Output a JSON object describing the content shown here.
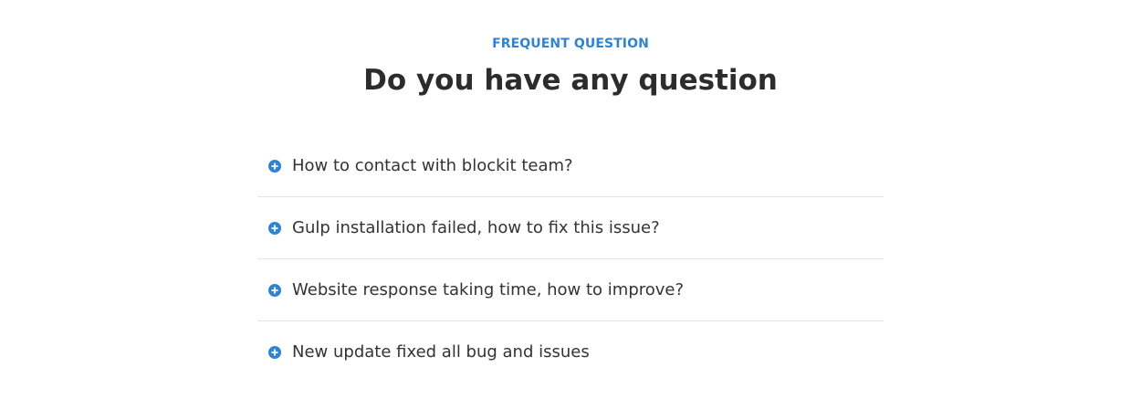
{
  "colors": {
    "accent": "#3083d1",
    "heading": "#2c2c2c",
    "text": "#333333",
    "divider": "#e5e5e5",
    "background": "#ffffff"
  },
  "faq": {
    "eyebrow": "FREQUENT QUESTION",
    "title": "Do you have any question",
    "items": [
      {
        "icon": "plus-circle-icon",
        "question": "How to contact with blockit team?"
      },
      {
        "icon": "plus-circle-icon",
        "question": "Gulp installation failed, how to fix this issue?"
      },
      {
        "icon": "plus-circle-icon",
        "question": "Website response taking time, how to improve?"
      },
      {
        "icon": "plus-circle-icon",
        "question": "New update fixed all bug and issues"
      }
    ]
  }
}
